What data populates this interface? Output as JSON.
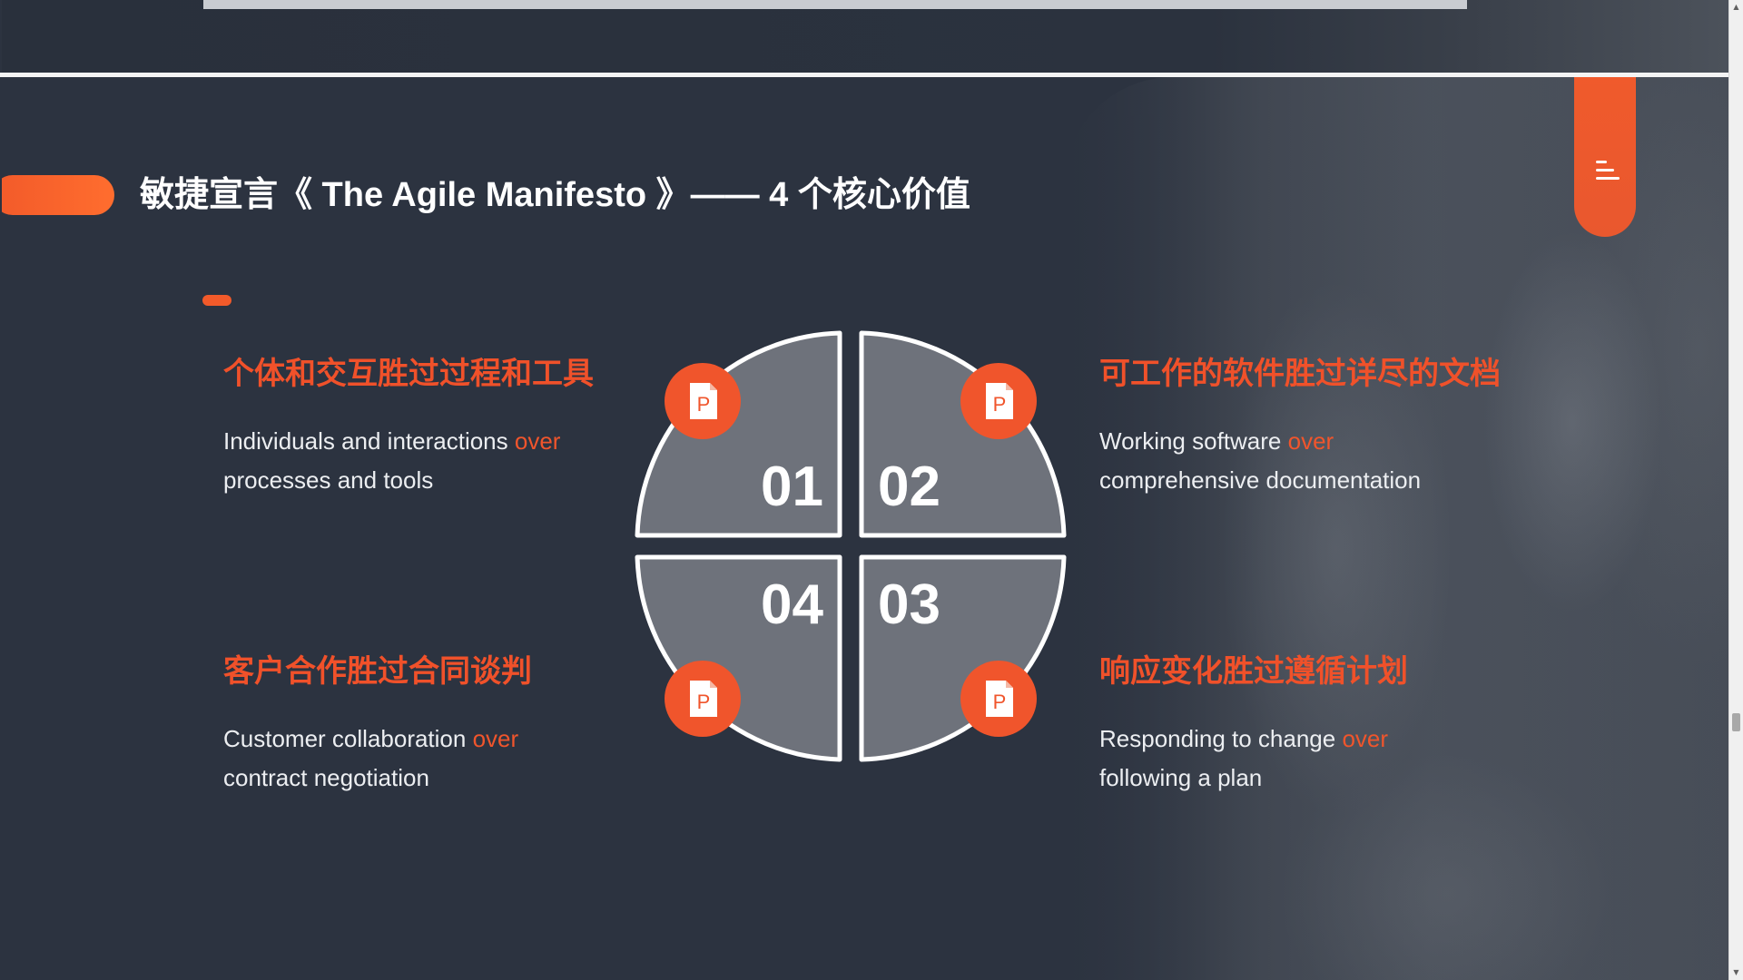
{
  "slide": {
    "title": "敏捷宣言《 The Agile Manifesto 》—— 4 个核心价值",
    "accent_color": "#f0512a",
    "background_color": "#2c3340",
    "items": [
      {
        "number": "01",
        "cn": "个体和交互胜过过程和工具",
        "en_left": "Individuals and interactions",
        "en_over": "over",
        "en_right": "processes and tools",
        "icon": "ppt-file-icon"
      },
      {
        "number": "02",
        "cn": "可工作的软件胜过详尽的文档",
        "en_left": "Working software",
        "en_over": "over",
        "en_right": "comprehensive documentation",
        "icon": "ppt-file-icon"
      },
      {
        "number": "03",
        "cn": "响应变化胜过遵循计划",
        "en_left": "Responding to change",
        "en_over": "over",
        "en_right": "following a plan",
        "icon": "ppt-file-icon"
      },
      {
        "number": "04",
        "cn": "客户合作胜过合同谈判",
        "en_left": "Customer collaboration",
        "en_over": "over",
        "en_right": "contract negotiation",
        "icon": "ppt-file-icon"
      }
    ],
    "menu_icon": "hamburger-menu-icon"
  },
  "scrollbar": {
    "up_arrow": "▲",
    "down_arrow": "▼"
  }
}
